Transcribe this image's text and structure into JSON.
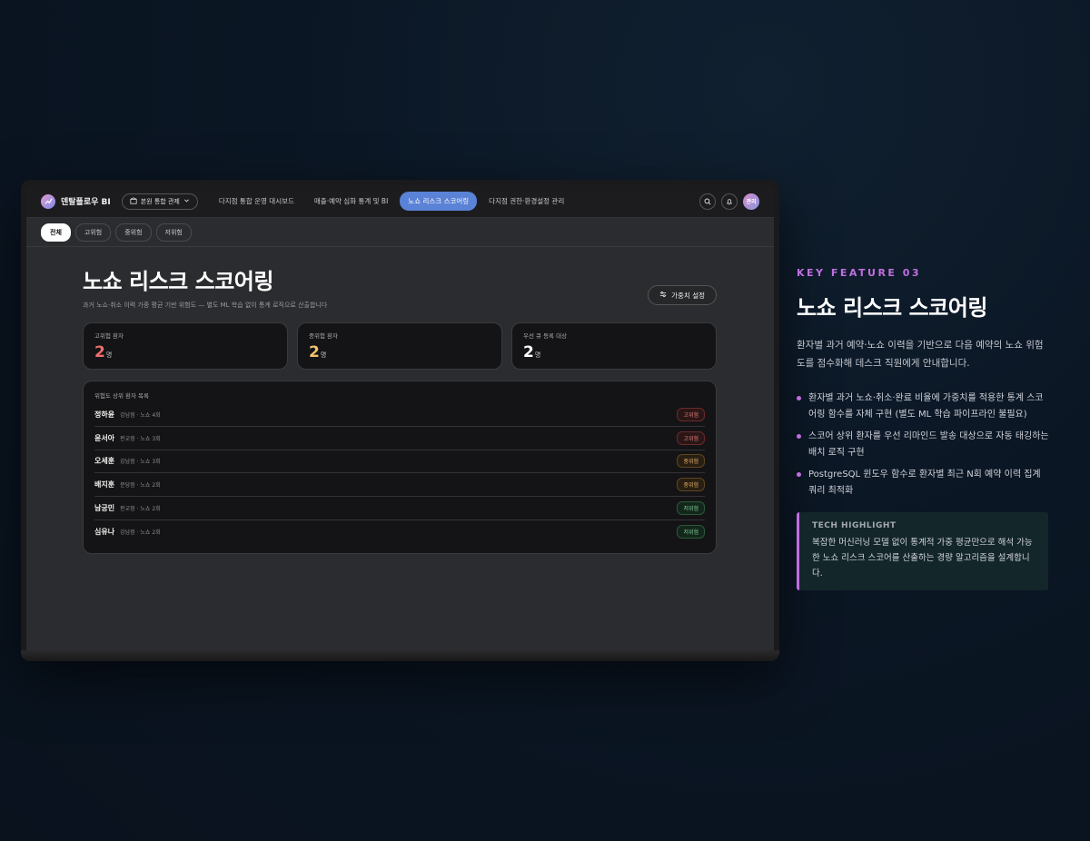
{
  "nav": {
    "brand": "덴탈플로우 BI",
    "branch_select": "본원 통합 관제",
    "items": [
      {
        "label": "다지점 통합 운영 대시보드"
      },
      {
        "label": "매출·예약 심화 통계 및 BI"
      },
      {
        "label": "노쇼 리스크 스코어링"
      },
      {
        "label": "다지점 권한·환경설정 관리"
      }
    ],
    "active_index": 2,
    "avatar": "관리"
  },
  "filters": [
    "전체",
    "고위험",
    "중위험",
    "저위험"
  ],
  "main": {
    "title": "노쇼 리스크 스코어링",
    "subtitle": "과거 노쇼·취소 이력 가중 평균 기반 위험도 — 별도 ML 학습 없이 통계 로직으로 산출합니다",
    "weight_button": "가중치 설정",
    "stats": [
      {
        "label": "고위험 환자",
        "value": "2",
        "unit": "명",
        "color": "#ef6f6c"
      },
      {
        "label": "중위험 환자",
        "value": "2",
        "unit": "명",
        "color": "#f2c06c"
      },
      {
        "label": "우선 큐 등록 대상",
        "value": "2",
        "unit": "명",
        "color": "#ffffff"
      }
    ],
    "list_title": "위험도 상위 환자 목록",
    "patients": [
      {
        "name": "정하윤",
        "meta": "강남점 · 노쇼 4회",
        "risk": "고위험"
      },
      {
        "name": "윤서아",
        "meta": "판교점 · 노쇼 3회",
        "risk": "고위험"
      },
      {
        "name": "오세훈",
        "meta": "강남점 · 노쇼 3회",
        "risk": "중위험"
      },
      {
        "name": "배지훈",
        "meta": "분당점 · 노쇼 2회",
        "risk": "중위험"
      },
      {
        "name": "남궁민",
        "meta": "판교점 · 노쇼 2회",
        "risk": "저위험"
      },
      {
        "name": "심유나",
        "meta": "강남점 · 노쇼 2회",
        "risk": "저위험"
      }
    ]
  },
  "side": {
    "kicker": "KEY FEATURE 03",
    "title": "노쇼 리스크 스코어링",
    "desc": "환자별 과거 예약·노쇼 이력을 기반으로 다음 예약의 노쇼 위험도를 점수화해 데스크 직원에게 안내합니다.",
    "bullets": [
      "환자별 과거 노쇼·취소·완료 비율에 가중치를 적용한 통계 스코어링 함수를 자체 구현 (별도 ML 학습 파이프라인 불필요)",
      "스코어 상위 환자를 우선 리마인드 발송 대상으로 자동 태깅하는 배치 로직 구현",
      "PostgreSQL 윈도우 함수로 환자별 최근 N회 예약 이력 집계 쿼리 최적화"
    ],
    "tech_label": "TECH HIGHLIGHT",
    "tech_text": "복잡한 머신러닝 모델 없이 통계적 가중 평균만으로 해석 가능한 노쇼 리스크 스코어를 산출하는 경량 알고리즘을 설계합니다."
  }
}
